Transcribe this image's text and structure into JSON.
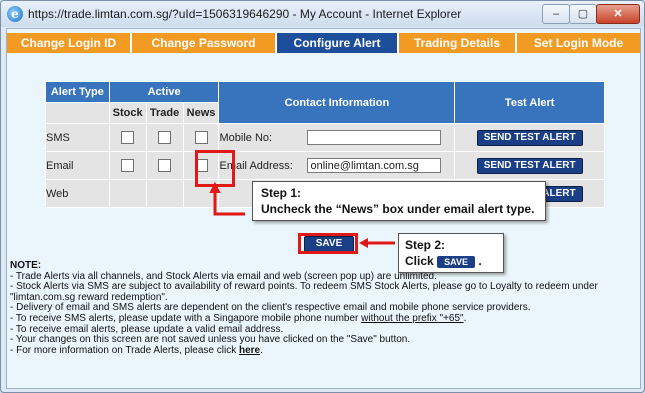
{
  "window": {
    "title": "https://trade.limtan.com.sg/?uId=1506319646290 - My Account - Internet Explorer",
    "min_label": "–",
    "max_label": "▢",
    "close_label": "✕"
  },
  "tabs": [
    {
      "label": "Change Login ID",
      "active": false
    },
    {
      "label": "Change Password",
      "active": false
    },
    {
      "label": "Configure Alert",
      "active": true
    },
    {
      "label": "Trading Details",
      "active": false
    },
    {
      "label": "Set Login Mode",
      "active": false
    }
  ],
  "table": {
    "headers": {
      "alert_type": "Alert Type",
      "active": "Active",
      "contact": "Contact Information",
      "test": "Test Alert"
    },
    "sub_headers": {
      "stock": "Stock",
      "trade": "Trade",
      "news": "News"
    },
    "rows": [
      {
        "type": "SMS",
        "contact_label": "Mobile No:",
        "contact_value": "",
        "test_label": "SEND TEST ALERT"
      },
      {
        "type": "Email",
        "contact_label": "Email Address:",
        "contact_value": "online@limtan.com.sg",
        "test_label": "SEND TEST ALERT"
      },
      {
        "type": "Web",
        "test_label": "SEND TEST ALERT"
      }
    ]
  },
  "save_label": "SAVE",
  "annotations": {
    "step1_title": "Step 1:",
    "step1_text": "Uncheck the “News” box under email alert type.",
    "step2_title": "Step 2:",
    "step2_text": "Click",
    "step2_button": "SAVE",
    "step2_end": "."
  },
  "notes": {
    "head": "NOTE:",
    "lines": [
      "- Trade Alerts via all channels, and Stock Alerts via email and web (screen pop up) are unlimited.",
      "- Stock Alerts via SMS are subject to availability of reward points. To redeem SMS Stock Alerts, please go to Loyalty to redeem under \"limtan.com.sg reward redemption\".",
      "- Delivery of email and SMS alerts are dependent on the client's respective email and mobile phone service providers."
    ],
    "line4_prefix": "- To receive SMS alerts, please update with a Singapore mobile phone number ",
    "line4_underlined": "without the prefix \"+65\"",
    "line4_suffix": ".",
    "line5": "- To receive email alerts, please update a valid email address.",
    "line6": "- Your changes on this screen are not saved unless you have clicked on the \"Save\" button.",
    "line7_prefix": "- For more information on Trade Alerts, please click ",
    "line7_link": "here",
    "line7_suffix": "."
  },
  "colors": {
    "tab_orange": "#f39a23",
    "tab_active": "#1d4e9b",
    "header_blue": "#3774bd",
    "button_navy": "#1b3f86",
    "annotation_red": "#e01818"
  }
}
